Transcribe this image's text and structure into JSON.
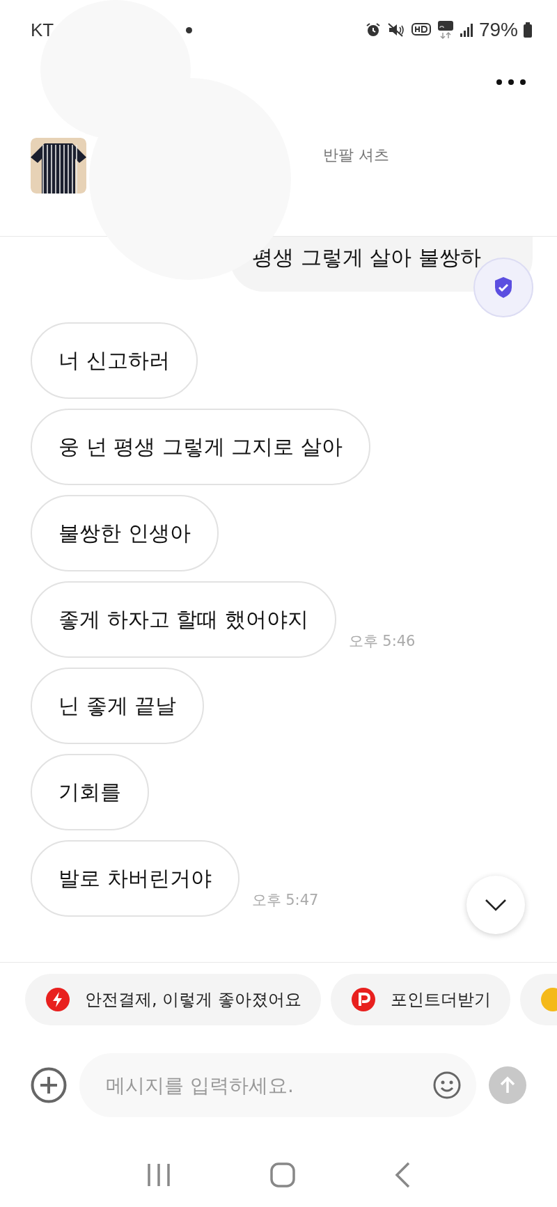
{
  "status_bar": {
    "carrier": "KT",
    "battery": "79%"
  },
  "product": {
    "title": "반팔 셔츠"
  },
  "messages": [
    {
      "kind": "out",
      "text": "평생 그렇게 살아 불쌍하"
    },
    {
      "kind": "in",
      "text": "너 신고하러"
    },
    {
      "kind": "in",
      "text": "웅 넌 평생 그렇게 그지로 살아"
    },
    {
      "kind": "in",
      "text": "불쌍한 인생아"
    },
    {
      "kind": "in",
      "text": "좋게 하자고 할때 했어야지",
      "time": "오후 5:46"
    },
    {
      "kind": "in",
      "text": "닌 좋게 끝날"
    },
    {
      "kind": "in",
      "text": "기회를"
    },
    {
      "kind": "in",
      "text": "발로 차버린거야",
      "time": "오후 5:47"
    }
  ],
  "chips": [
    {
      "kind": "bolt",
      "label": "안전결제, 이렇게 좋아졌어요"
    },
    {
      "kind": "point",
      "label": "포인트더받기"
    },
    {
      "kind": "coin"
    }
  ],
  "composer": {
    "placeholder": "메시지를 입력하세요."
  }
}
